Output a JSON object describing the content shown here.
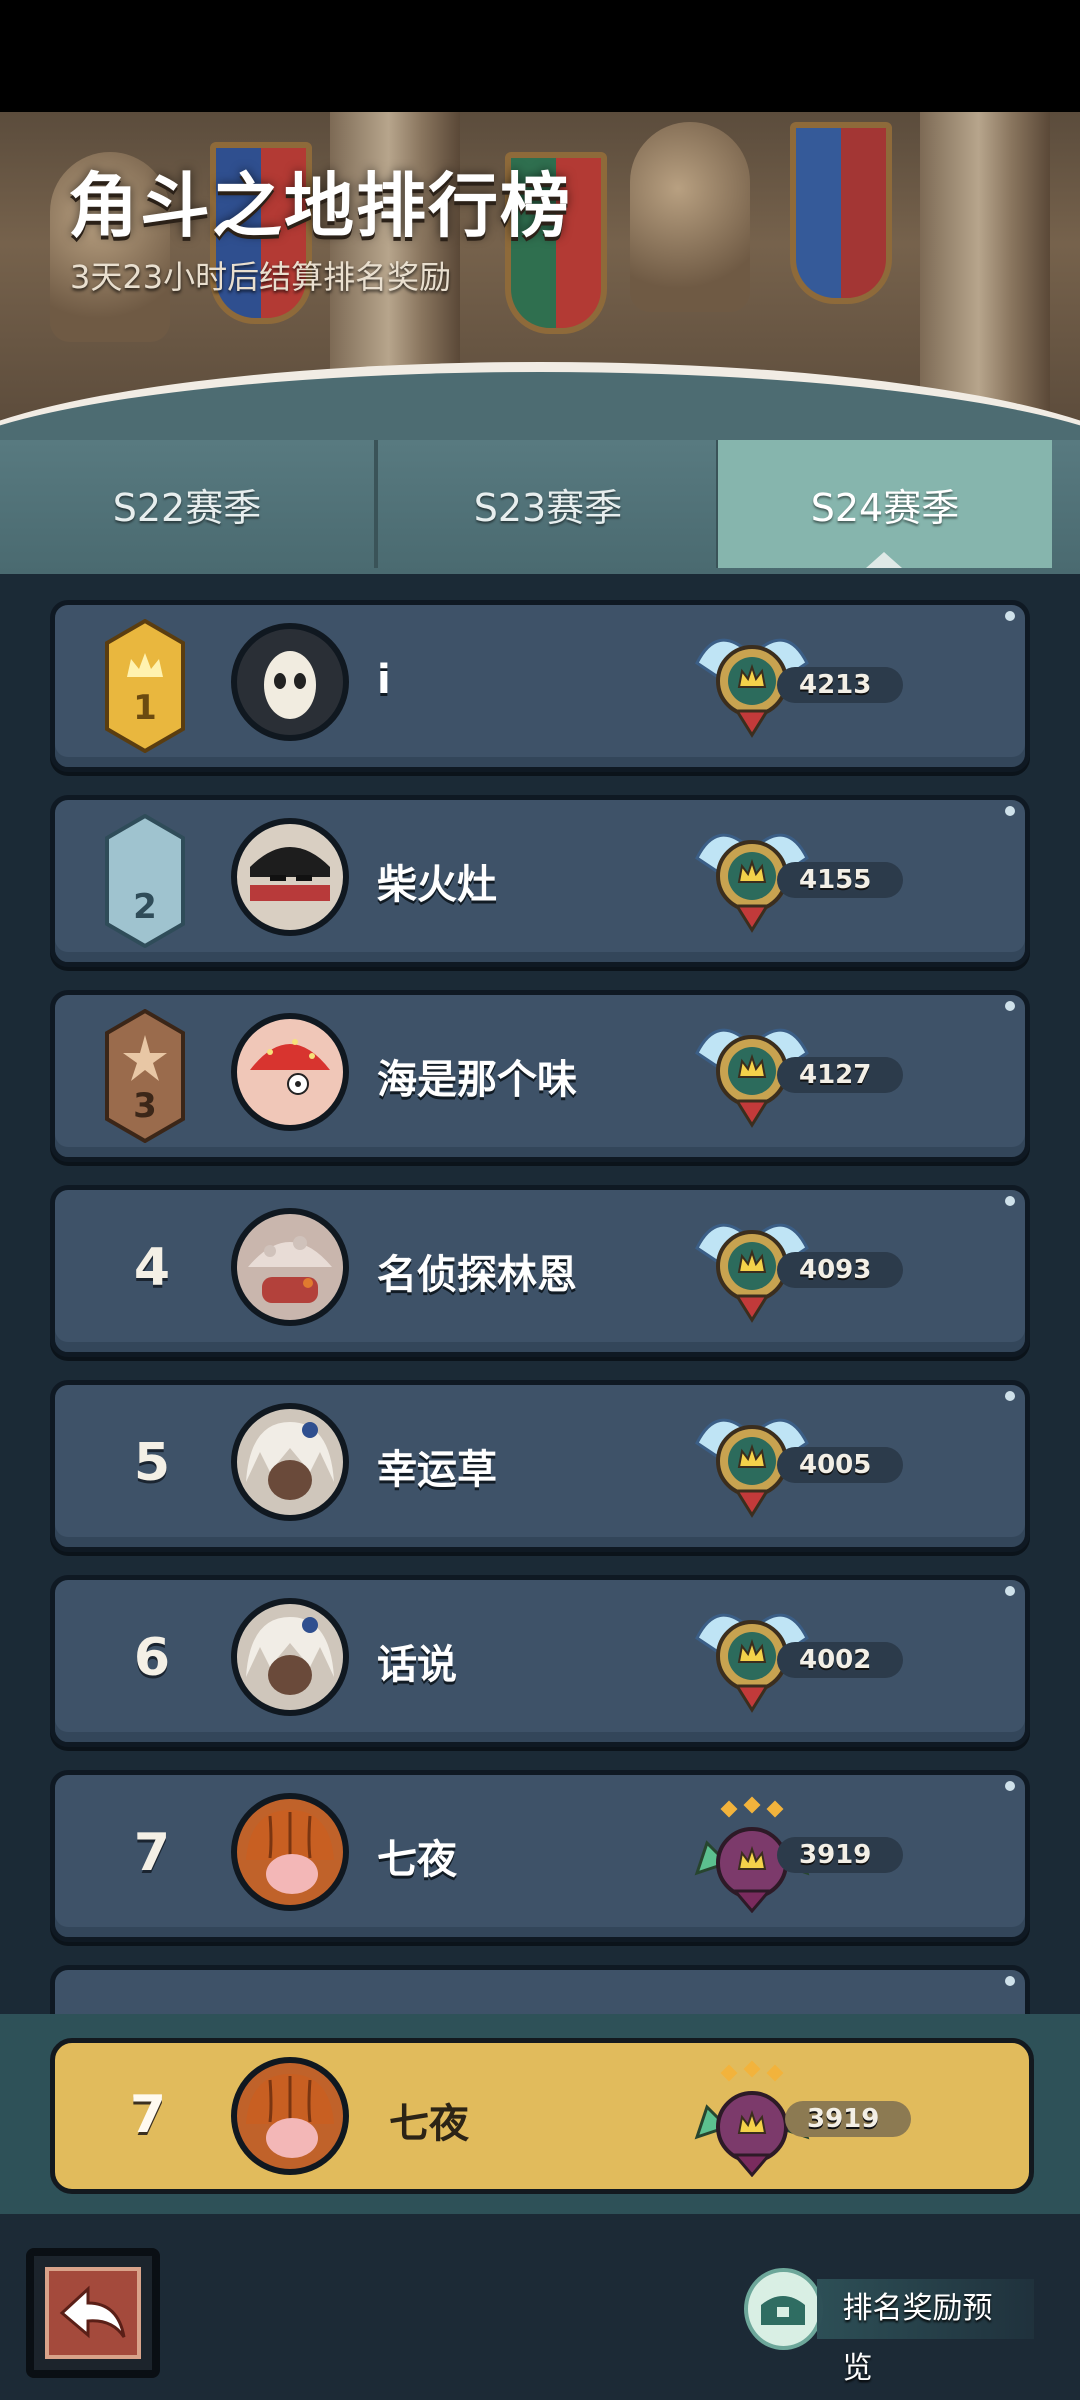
{
  "header": {
    "title": "角斗之地排行榜",
    "subtitle": "3天23小时后结算排名奖励"
  },
  "tabs": [
    {
      "label": "S22赛季",
      "selected": false
    },
    {
      "label": "S23赛季",
      "selected": false
    },
    {
      "label": "S24赛季",
      "selected": true
    }
  ],
  "colors": {
    "gold_medal": "#e9b73e",
    "silver_medal": "#9fc3cf",
    "bronze_medal": "#9a6b4c",
    "row_bg": "#3e5268",
    "self_row_bg": "#e1bb5c",
    "selected_tab": "#86b5ad"
  },
  "leaderboard": [
    {
      "rank": "1",
      "medal": "gold",
      "name": "i",
      "avatar": "hooded-mask-avatar",
      "tier_icon": "winged-crown-emblem",
      "score": "4213"
    },
    {
      "rank": "2",
      "medal": "silver",
      "name": "柴火灶",
      "avatar": "bandana-ninja-avatar",
      "tier_icon": "winged-crown-emblem",
      "score": "4155"
    },
    {
      "rank": "3",
      "medal": "bronze",
      "name": "海是那个味",
      "avatar": "strawberry-hat-avatar",
      "tier_icon": "winged-crown-emblem",
      "score": "4127"
    },
    {
      "rank": "4",
      "medal": "",
      "name": "名侦探林恩",
      "avatar": "snow-hat-avatar",
      "tier_icon": "winged-crown-emblem",
      "score": "4093"
    },
    {
      "rank": "5",
      "medal": "",
      "name": "幸运草",
      "avatar": "white-hair-avatar",
      "tier_icon": "winged-crown-emblem",
      "score": "4005"
    },
    {
      "rank": "6",
      "medal": "",
      "name": "话说",
      "avatar": "white-hair-avatar",
      "tier_icon": "winged-crown-emblem",
      "score": "4002"
    },
    {
      "rank": "7",
      "medal": "",
      "name": "七夜",
      "avatar": "pumpkin-head-avatar",
      "tier_icon": "leaf-crown-emblem",
      "score": "3919"
    }
  ],
  "self_entry": {
    "rank": "7",
    "name": "七夜",
    "avatar": "pumpkin-head-avatar",
    "tier_icon": "leaf-crown-emblem",
    "score": "3919"
  },
  "footer": {
    "back_icon": "back-arrow-icon",
    "reward_preview_label": "排名奖励预览",
    "reward_preview_icon": "reward-chest-icon"
  }
}
